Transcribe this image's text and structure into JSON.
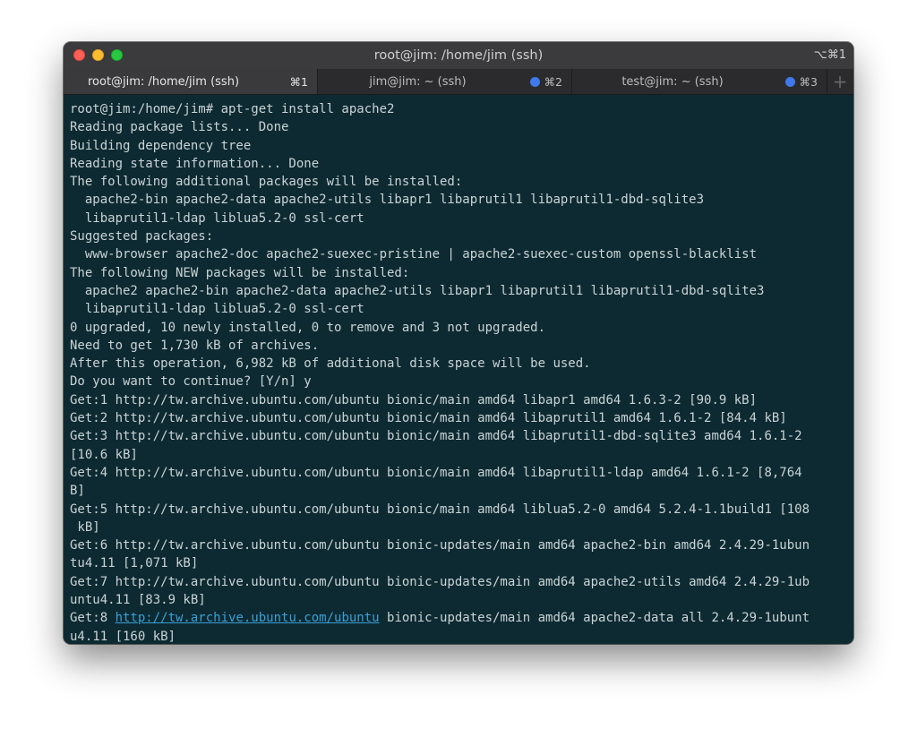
{
  "window": {
    "title": "root@jim: /home/jim (ssh)",
    "shortcut": "⌥⌘1"
  },
  "tabs": [
    {
      "label": "root@jim: /home/jim (ssh)",
      "shortcut": "⌘1",
      "active": true,
      "indicator": false
    },
    {
      "label": "jim@jim: ~ (ssh)",
      "shortcut": "⌘2",
      "active": false,
      "indicator": true
    },
    {
      "label": "test@jim: ~ (ssh)",
      "shortcut": "⌘3",
      "active": false,
      "indicator": true
    }
  ],
  "new_tab_label": "+",
  "terminal": {
    "lines": [
      "root@jim:/home/jim# apt-get install apache2",
      "Reading package lists... Done",
      "Building dependency tree",
      "Reading state information... Done",
      "The following additional packages will be installed:",
      "  apache2-bin apache2-data apache2-utils libapr1 libaprutil1 libaprutil1-dbd-sqlite3",
      "  libaprutil1-ldap liblua5.2-0 ssl-cert",
      "Suggested packages:",
      "  www-browser apache2-doc apache2-suexec-pristine | apache2-suexec-custom openssl-blacklist",
      "The following NEW packages will be installed:",
      "  apache2 apache2-bin apache2-data apache2-utils libapr1 libaprutil1 libaprutil1-dbd-sqlite3",
      "  libaprutil1-ldap liblua5.2-0 ssl-cert",
      "0 upgraded, 10 newly installed, 0 to remove and 3 not upgraded.",
      "Need to get 1,730 kB of archives.",
      "After this operation, 6,982 kB of additional disk space will be used.",
      "Do you want to continue? [Y/n] y",
      "Get:1 http://tw.archive.ubuntu.com/ubuntu bionic/main amd64 libapr1 amd64 1.6.3-2 [90.9 kB]",
      "Get:2 http://tw.archive.ubuntu.com/ubuntu bionic/main amd64 libaprutil1 amd64 1.6.1-2 [84.4 kB]",
      "Get:3 http://tw.archive.ubuntu.com/ubuntu bionic/main amd64 libaprutil1-dbd-sqlite3 amd64 1.6.1-2",
      "[10.6 kB]",
      "Get:4 http://tw.archive.ubuntu.com/ubuntu bionic/main amd64 libaprutil1-ldap amd64 1.6.1-2 [8,764",
      "B]",
      "Get:5 http://tw.archive.ubuntu.com/ubuntu bionic/main amd64 liblua5.2-0 amd64 5.2.4-1.1build1 [108",
      " kB]",
      "Get:6 http://tw.archive.ubuntu.com/ubuntu bionic-updates/main amd64 apache2-bin amd64 2.4.29-1ubun",
      "tu4.11 [1,071 kB]",
      "Get:7 http://tw.archive.ubuntu.com/ubuntu bionic-updates/main amd64 apache2-utils amd64 2.4.29-1ub",
      "untu4.11 [83.9 kB]"
    ],
    "last_line": {
      "prefix": "Get:8 ",
      "link": "http://tw.archive.ubuntu.com/ubuntu",
      "suffix": " bionic-updates/main amd64 apache2-data all 2.4.29-1ubunt"
    },
    "final_line": "u4.11 [160 kB]"
  },
  "colors": {
    "terminal_bg": "#0d2a32",
    "terminal_fg": "#cad3d5",
    "link": "#3aa0d6",
    "tab_indicator": "#3f79ea"
  }
}
